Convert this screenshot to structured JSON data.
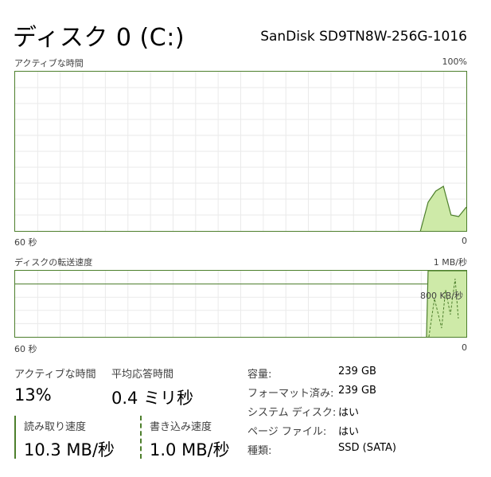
{
  "header": {
    "title": "ディスク 0 (C:)",
    "model": "SanDisk SD9TN8W-256G-1016"
  },
  "active_time_graph": {
    "label": "アクティブな時間",
    "max_label": "100%",
    "left_time_label": "60 秒",
    "right_time_label": "0",
    "values_percent": [
      0,
      0,
      0,
      0,
      0,
      0,
      0,
      0,
      0,
      0,
      0,
      0,
      0,
      0,
      0,
      0,
      0,
      0,
      0,
      0,
      0,
      0,
      0,
      0,
      0,
      0,
      0,
      0,
      0,
      0,
      0,
      0,
      0,
      0,
      0,
      0,
      0,
      0,
      0,
      0,
      0,
      0,
      0,
      0,
      0,
      0,
      0,
      0,
      0,
      0,
      0,
      0,
      0,
      0,
      18,
      25,
      28,
      10,
      9,
      15
    ]
  },
  "transfer_graph": {
    "label": "ディスクの転送速度",
    "max_label": "1 MB/秒",
    "mid_label": "800 KB/秒",
    "left_time_label": "60 秒",
    "right_time_label": "0"
  },
  "stats": {
    "active_time_label": "アクティブな時間",
    "active_time_value": "13%",
    "avg_response_label": "平均応答時間",
    "avg_response_value": "0.4 ミリ秒",
    "read_speed_label": "読み取り速度",
    "read_speed_value": "10.3 MB/秒",
    "write_speed_label": "書き込み速度",
    "write_speed_value": "1.0 MB/秒"
  },
  "properties": [
    {
      "label": "容量:",
      "value": "239 GB"
    },
    {
      "label": "フォーマット済み:",
      "value": "239 GB"
    },
    {
      "label": "システム ディスク:",
      "value": "はい"
    },
    {
      "label": "ページ ファイル:",
      "value": "はい"
    },
    {
      "label": "種類:",
      "value": "SSD (SATA)"
    }
  ],
  "colors": {
    "graph_border": "#4d7f2c",
    "graph_fill": "#ceeaa8",
    "grid": "#eaeaea"
  }
}
